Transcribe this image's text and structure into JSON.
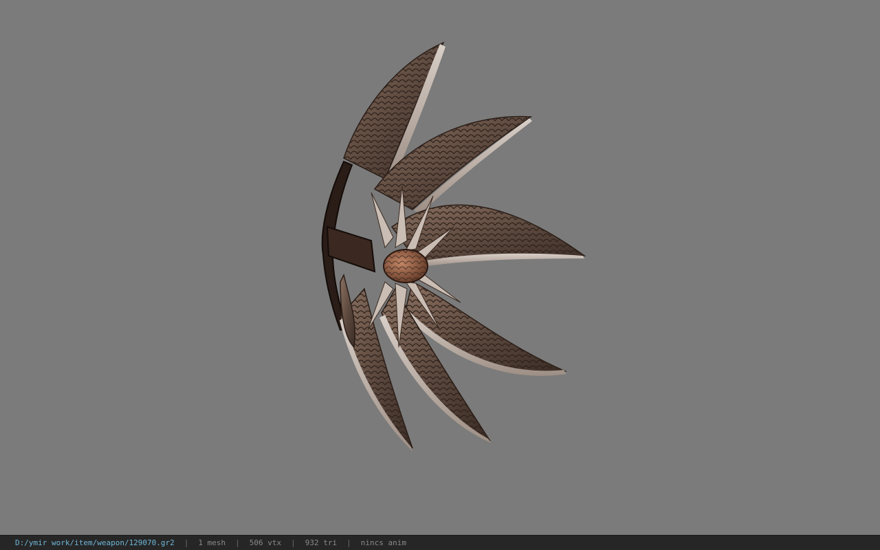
{
  "viewport": {
    "background": "#7b7b7b",
    "model_name": "winged bow weapon model"
  },
  "statusbar": {
    "file_path": "D:/ymir work/item/weapon/129070.gr2",
    "separator": "|",
    "mesh_count": "1 mesh",
    "vertex_count": "506 vtx",
    "triangle_count": "932 tri",
    "anim_status": "nincs anim",
    "path_color": "#6fb6d8"
  }
}
